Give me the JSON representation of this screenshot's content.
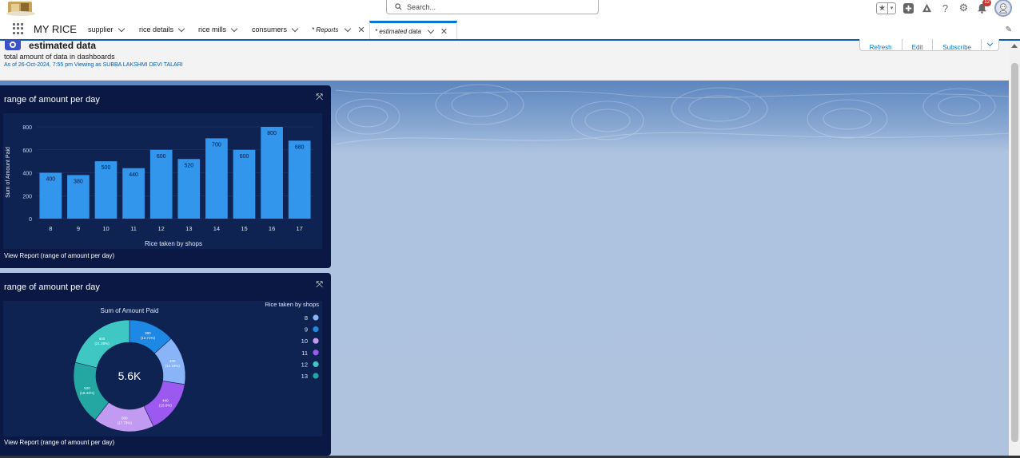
{
  "header": {
    "search_placeholder": "Search...",
    "notification_count": "12"
  },
  "nav": {
    "app_name": "MY RICE",
    "items": [
      {
        "label": "supplier"
      },
      {
        "label": "rice details"
      },
      {
        "label": "rice mills"
      },
      {
        "label": "consumers"
      }
    ],
    "tabs": [
      {
        "label": "* Reports"
      },
      {
        "label": "* estimated data"
      }
    ]
  },
  "dashboard": {
    "title": "estimated data",
    "subtitle": "total amount of data in dashboards",
    "as_of": "As of 26-Oct-2024, 7:55 pm Viewing as SUBBA LAKSHMI DEVI TALARI",
    "buttons": {
      "refresh": "Refresh",
      "edit": "Edit",
      "subscribe": "Subscribe"
    }
  },
  "widgets": [
    {
      "title": "range of amount per day",
      "link": "View Report (range of amount per day)"
    },
    {
      "title": "range of amount per day",
      "link": "View Report (range of amount per day)"
    }
  ],
  "colors": {
    "nav_accent": "#0b5cab",
    "widget_bg": "#0a1843",
    "bar": "#3296ed"
  },
  "chart_data": [
    {
      "type": "bar",
      "categories": [
        "8",
        "9",
        "10",
        "11",
        "12",
        "13",
        "14",
        "15",
        "16",
        "17"
      ],
      "values": [
        400,
        380,
        500,
        440,
        600,
        520,
        700,
        600,
        800,
        680
      ],
      "xlabel": "Rice taken by shops",
      "ylabel": "Sum of Amount Paid",
      "ylim": [
        0,
        800
      ],
      "yticks": [
        0,
        200,
        400,
        600,
        800
      ],
      "data_labels": [
        "400",
        "380",
        "500",
        "440",
        "600",
        "520",
        "700",
        "600",
        "800",
        "680"
      ],
      "grid": true
    },
    {
      "type": "pie",
      "title": "Sum of Amount Paid",
      "center_label": "5.6K",
      "legend_title": "Rice taken by shops",
      "legend_position": "top-right",
      "categories": [
        "8",
        "9",
        "10",
        "11",
        "12",
        "13"
      ],
      "values": [
        400,
        380,
        500,
        440,
        600,
        520
      ],
      "slice_labels": [
        "380\n(12.71%)",
        "400\n(14.18%)",
        "440\n(15.6%)",
        "500\n(17.73%)",
        "520\n(18.44%)",
        "600\n(21.28%)"
      ],
      "colors": [
        "#8ab4f8",
        "#1e88e5",
        "#c39af1",
        "#9b59f0",
        "#3ec7c3",
        "#24a7a3"
      ]
    }
  ]
}
